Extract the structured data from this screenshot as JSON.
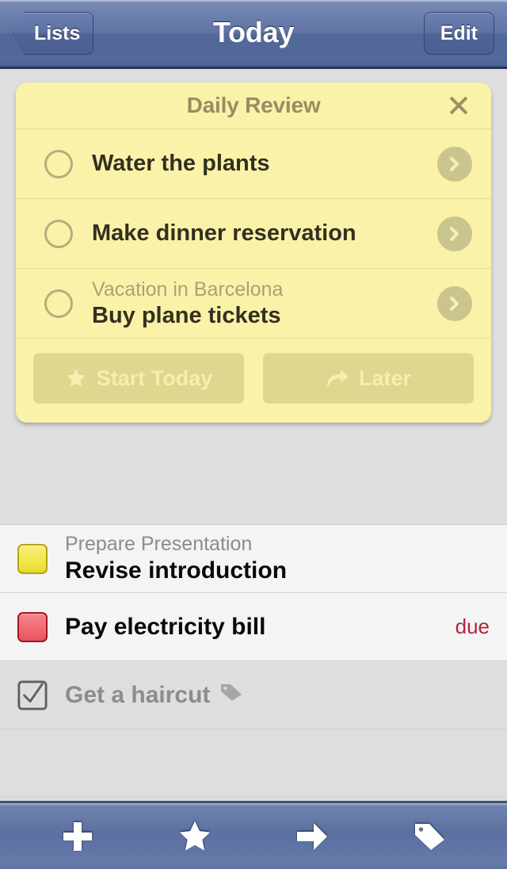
{
  "app": {
    "accent_blue": "#53689a",
    "card_yellow": "#faf2a8",
    "due_red": "#b5243a",
    "row_light": "#f4f4f4",
    "page_grey": "#dededf"
  },
  "navbar": {
    "back_label": "Lists",
    "title": "Today",
    "edit_label": "Edit",
    "back_icon": "chevron-left-icon",
    "title_name": "page-title"
  },
  "review_card": {
    "title": "Daily Review",
    "close_icon": "close-icon",
    "rows": [
      {
        "subtitle": "",
        "title": "Water the plants",
        "checkbox": "circle-unchecked-icon",
        "disclosure": "chevron-right-icon"
      },
      {
        "subtitle": "",
        "title": "Make dinner reservation",
        "checkbox": "circle-unchecked-icon",
        "disclosure": "chevron-right-icon"
      },
      {
        "subtitle": "Vacation in Barcelona",
        "title": "Buy plane tickets",
        "checkbox": "circle-unchecked-icon",
        "disclosure": "chevron-right-icon"
      }
    ],
    "actions": [
      {
        "label": "Start Today",
        "icon": "star-icon"
      },
      {
        "label": "Later",
        "icon": "forward-arrow-icon"
      }
    ]
  },
  "task_list": {
    "rows": [
      {
        "subtitle": "Prepare Presentation",
        "title": "Revise introduction",
        "checkbox": "checkbox-yellow",
        "checkbox_color": "#f2e74e",
        "due": "",
        "tag_icon": "",
        "completed": false
      },
      {
        "subtitle": "",
        "title": "Pay electricity bill",
        "checkbox": "checkbox-red",
        "checkbox_color": "#ef6a73",
        "due": "due",
        "tag_icon": "",
        "completed": false
      },
      {
        "subtitle": "",
        "title": "Get a haircut",
        "checkbox": "checkbox-checked",
        "checkbox_color": "#6e6e6e",
        "due": "",
        "tag_icon": "tag-icon",
        "completed": true
      }
    ],
    "empty_row_count": 2
  },
  "toolbar": {
    "buttons": [
      {
        "icon": "plus-icon",
        "name": "add-task-button"
      },
      {
        "icon": "star-icon",
        "name": "star-filter-button"
      },
      {
        "icon": "arrow-right-icon",
        "name": "move-button"
      },
      {
        "icon": "tag-icon",
        "name": "tag-button"
      }
    ]
  }
}
